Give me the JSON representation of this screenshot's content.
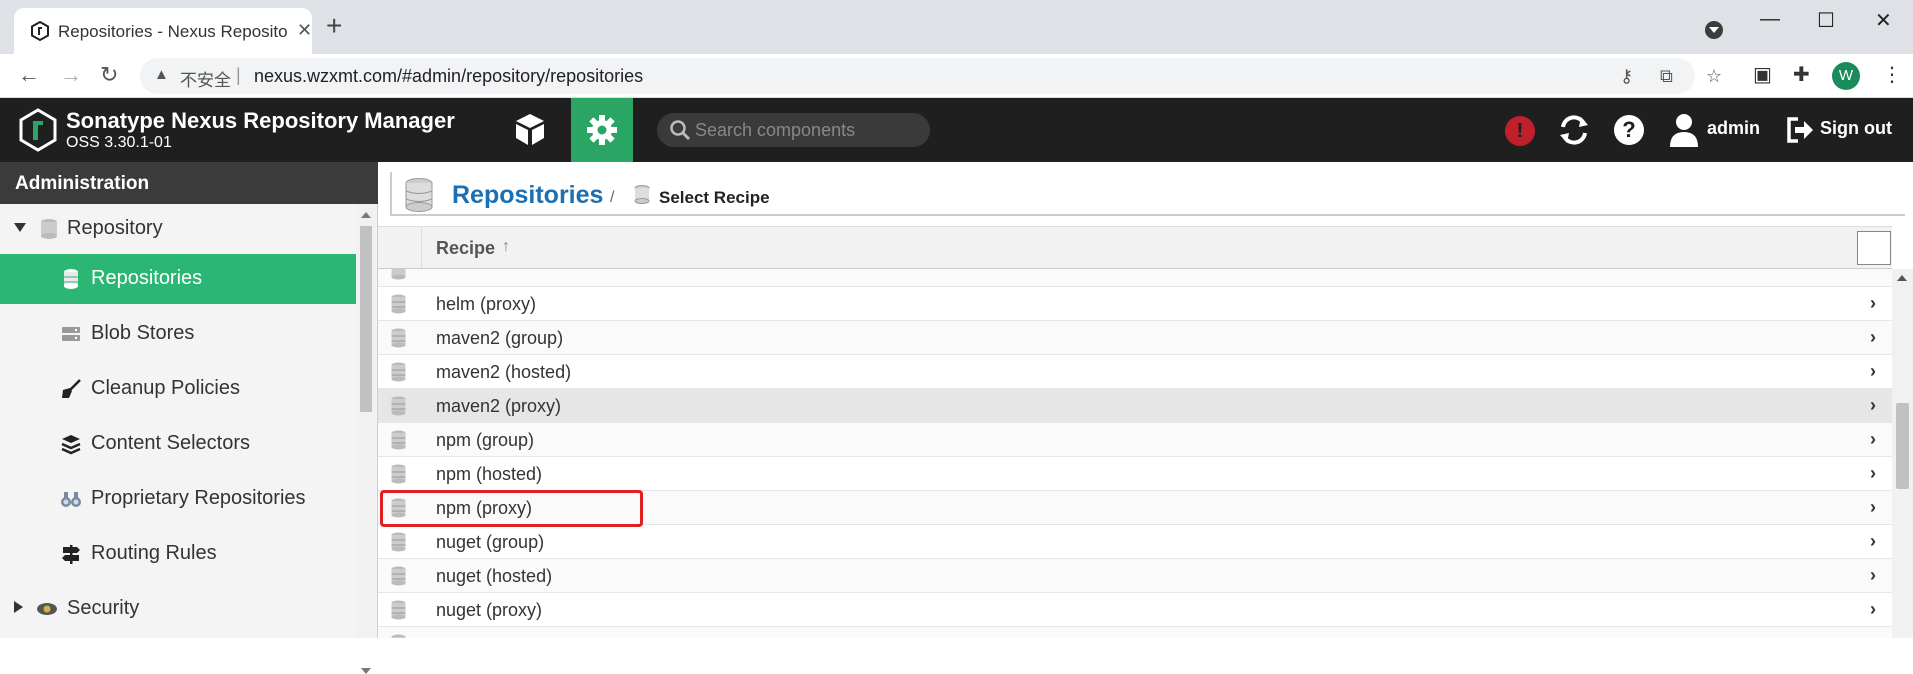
{
  "browser": {
    "tab_title": "Repositories - Nexus Reposito",
    "url_warning": "不安全",
    "url": "nexus.wzxmt.com/#admin/repository/repositories",
    "profile_initial": "W"
  },
  "header": {
    "app_title": "Sonatype Nexus Repository Manager",
    "version": "OSS 3.30.1-01",
    "search_placeholder": "Search components",
    "user": "admin",
    "sign_out": "Sign out",
    "accent_color": "#2ba564"
  },
  "sidebar": {
    "heading": "Administration",
    "items": [
      {
        "label": "Repository",
        "icon": "database-icon"
      },
      {
        "label": "Repositories",
        "icon": "database-icon"
      },
      {
        "label": "Blob Stores",
        "icon": "server-icon"
      },
      {
        "label": "Cleanup Policies",
        "icon": "broom-icon"
      },
      {
        "label": "Content Selectors",
        "icon": "layers-icon"
      },
      {
        "label": "Proprietary Repositories",
        "icon": "binoculars-icon"
      },
      {
        "label": "Routing Rules",
        "icon": "signpost-icon"
      },
      {
        "label": "Security",
        "icon": "badge-icon"
      }
    ]
  },
  "main": {
    "title": "Repositories",
    "breadcrumb_sep": "/",
    "subtitle": "Select Recipe",
    "column_header": "Recipe",
    "rows": [
      {
        "label": "helm (proxy)"
      },
      {
        "label": "maven2 (group)"
      },
      {
        "label": "maven2 (hosted)"
      },
      {
        "label": "maven2 (proxy)"
      },
      {
        "label": "npm (group)"
      },
      {
        "label": "npm (hosted)"
      },
      {
        "label": "npm (proxy)"
      },
      {
        "label": "nuget (group)"
      },
      {
        "label": "nuget (hosted)"
      },
      {
        "label": "nuget (proxy)"
      }
    ],
    "highlighted_row": "maven2 (proxy)"
  }
}
